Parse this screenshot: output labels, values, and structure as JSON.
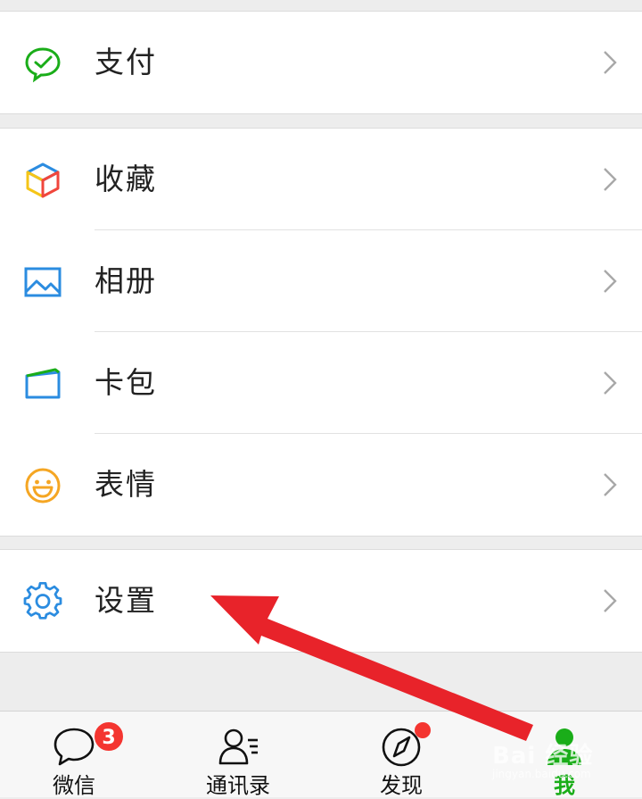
{
  "menu": {
    "payment": {
      "label": "支付",
      "icon": "wechat-pay-icon"
    },
    "favorites": {
      "label": "收藏",
      "icon": "cube-icon"
    },
    "album": {
      "label": "相册",
      "icon": "picture-icon"
    },
    "cards": {
      "label": "卡包",
      "icon": "wallet-card-icon"
    },
    "stickers": {
      "label": "表情",
      "icon": "smiley-icon"
    },
    "settings": {
      "label": "设置",
      "icon": "gear-icon"
    }
  },
  "tabbar": {
    "tabs": [
      {
        "label": "微信",
        "icon": "chat-bubble-icon",
        "badge": "3"
      },
      {
        "label": "通讯录",
        "icon": "contacts-icon"
      },
      {
        "label": "发现",
        "icon": "compass-icon",
        "dot": true
      },
      {
        "label": "我",
        "icon": "person-icon",
        "active": true
      }
    ]
  },
  "watermark": {
    "text": "Bai 经验",
    "sub": "jingyan.baidu.com"
  },
  "colors": {
    "accent_green": "#1aad19",
    "badge_red": "#f43530",
    "icon_blue": "#2b8ce0",
    "icon_orange": "#f5a623",
    "arrow_red": "#e8232a",
    "background": "#ededed"
  }
}
